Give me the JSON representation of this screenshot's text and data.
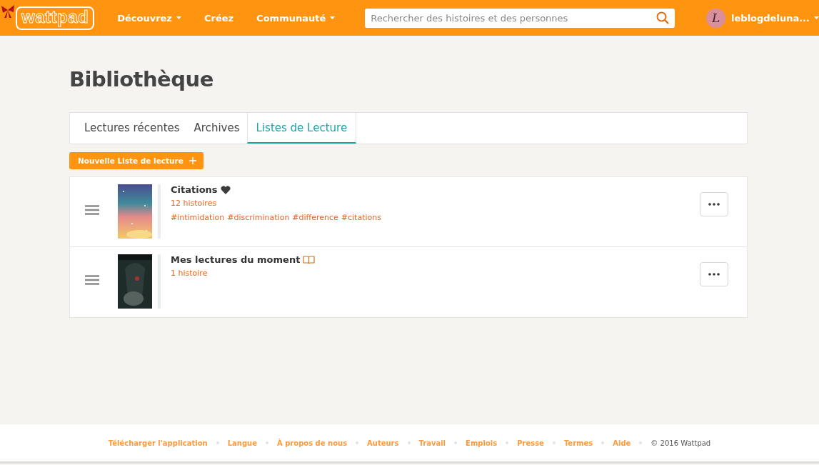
{
  "header": {
    "logo": "wattpad",
    "nav": [
      {
        "label": "Découvrez",
        "dropdown": true
      },
      {
        "label": "Créez",
        "dropdown": false
      },
      {
        "label": "Communauté",
        "dropdown": true
      }
    ],
    "search": {
      "placeholder": "Rechercher des histoires et des personnes"
    },
    "user": {
      "name": "leblogdeluna...",
      "avatar_letter": "L"
    }
  },
  "page": {
    "title": "Bibliothèque"
  },
  "tabs": [
    {
      "label": "Lectures récentes",
      "selected": false
    },
    {
      "label": "Archives",
      "selected": false
    },
    {
      "label": "Listes de Lecture",
      "selected": true
    }
  ],
  "new_list_button": {
    "label": "Nouvelle Liste de lecture"
  },
  "reading_lists": [
    {
      "title": "Citations",
      "count": "12 histoires",
      "tags": [
        "#intimidation",
        "#discrimination",
        "#difference",
        "#citations"
      ]
    },
    {
      "title": "Mes lectures du moment",
      "count": "1 histoire"
    }
  ],
  "footer": {
    "links": [
      "Télécharger l'application",
      "Langue",
      "À propos de nous",
      "Auteurs",
      "Travail",
      "Emplois",
      "Presse",
      "Termes",
      "Aide"
    ],
    "copyright": "© 2016 Wattpad"
  }
}
